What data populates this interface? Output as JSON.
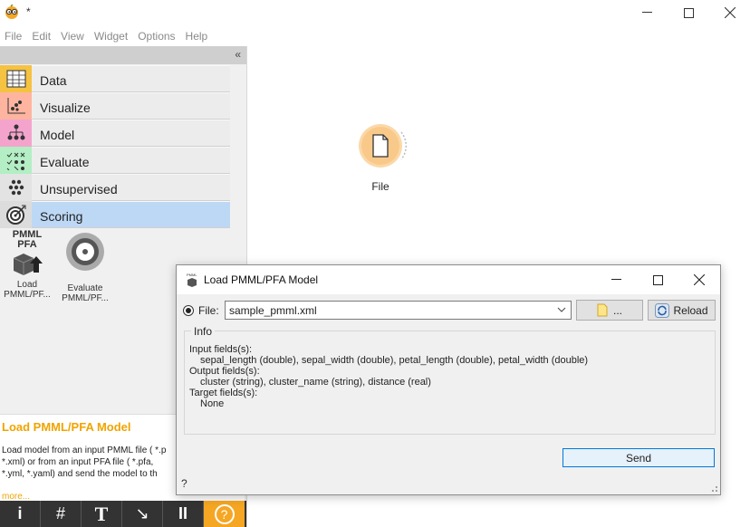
{
  "window": {
    "title": "*"
  },
  "menu": [
    "File",
    "Edit",
    "View",
    "Widget",
    "Options",
    "Help"
  ],
  "categories": [
    {
      "label": "Data",
      "color": "#f5c242",
      "icon": "table-icon"
    },
    {
      "label": "Visualize",
      "color": "#ffb4a0",
      "icon": "scatter-icon"
    },
    {
      "label": "Model",
      "color": "#f4a4cc",
      "icon": "tree-icon"
    },
    {
      "label": "Evaluate",
      "color": "#b3eec4",
      "icon": "evaluate-icon"
    },
    {
      "label": "Unsupervised",
      "color": "#e3e3e3",
      "icon": "clusters-icon"
    },
    {
      "label": "Scoring",
      "color": "#bcd8f5",
      "icon": "target-icon"
    }
  ],
  "widgets": [
    {
      "top": "PMML",
      "top2": "PFA",
      "label": "Load PMML/PF...",
      "icon": "load-model-icon"
    },
    {
      "label": "Evaluate PMML/PF...",
      "icon": "evaluate-model-icon"
    }
  ],
  "description": {
    "title": "Load PMML/PFA Model",
    "lines": [
      "Load model from an input PMML file ( *.p",
      "*.xml) or from an input PFA file ( *.pfa,",
      "*.yml, *.yaml) and send the model to th"
    ],
    "more": "more..."
  },
  "toolbar": [
    "i",
    "#",
    "T",
    "↘",
    "II",
    "?"
  ],
  "node": {
    "label": "File"
  },
  "dialog": {
    "title": "Load PMML/PFA Model",
    "file_label": "File:",
    "file_value": "sample_pmml.xml",
    "browse_label": "...",
    "reload_label": "Reload",
    "info_title": "Info",
    "input_heading": "Input fields(s):",
    "input_fields": "sepal_length (double), sepal_width (double), petal_length (double), petal_width (double)",
    "output_heading": "Output fields(s):",
    "output_fields": "cluster (string), cluster_name (string), distance (real)",
    "target_heading": "Target fields(s):",
    "target_fields": "None",
    "send_label": "Send",
    "help": "?"
  }
}
